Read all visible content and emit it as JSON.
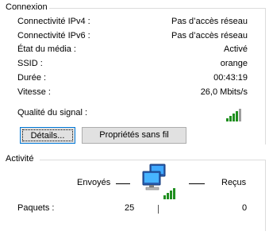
{
  "connection": {
    "title": "Connexion",
    "rows": [
      {
        "label": "Connectivité IPv4 :",
        "value": "Pas d’accès réseau"
      },
      {
        "label": "Connectivité IPv6 :",
        "value": "Pas d’accès réseau"
      },
      {
        "label": "État du média :",
        "value": "Activé"
      },
      {
        "label": "SSID :",
        "value": "orange"
      },
      {
        "label": "Durée :",
        "value": "00:43:19"
      },
      {
        "label": "Vitesse :",
        "value": "26,0 Mbits/s"
      }
    ],
    "signal_label": "Qualité du signal :",
    "signal_icon": "signal-strength-icon",
    "details_button": "Détails...",
    "wireless_props_button": "Propriétés sans fil"
  },
  "activity": {
    "title": "Activité",
    "sent_label": "Envoyés",
    "received_label": "Reçus",
    "packets_label": "Paquets :",
    "packets_sent": "25",
    "packets_received": "0",
    "network_icon": "network-computers-icon"
  },
  "colors": {
    "signal_green": "#1f8f1f",
    "button_face": "#e1e1e1",
    "focus_border": "#0078d7"
  }
}
